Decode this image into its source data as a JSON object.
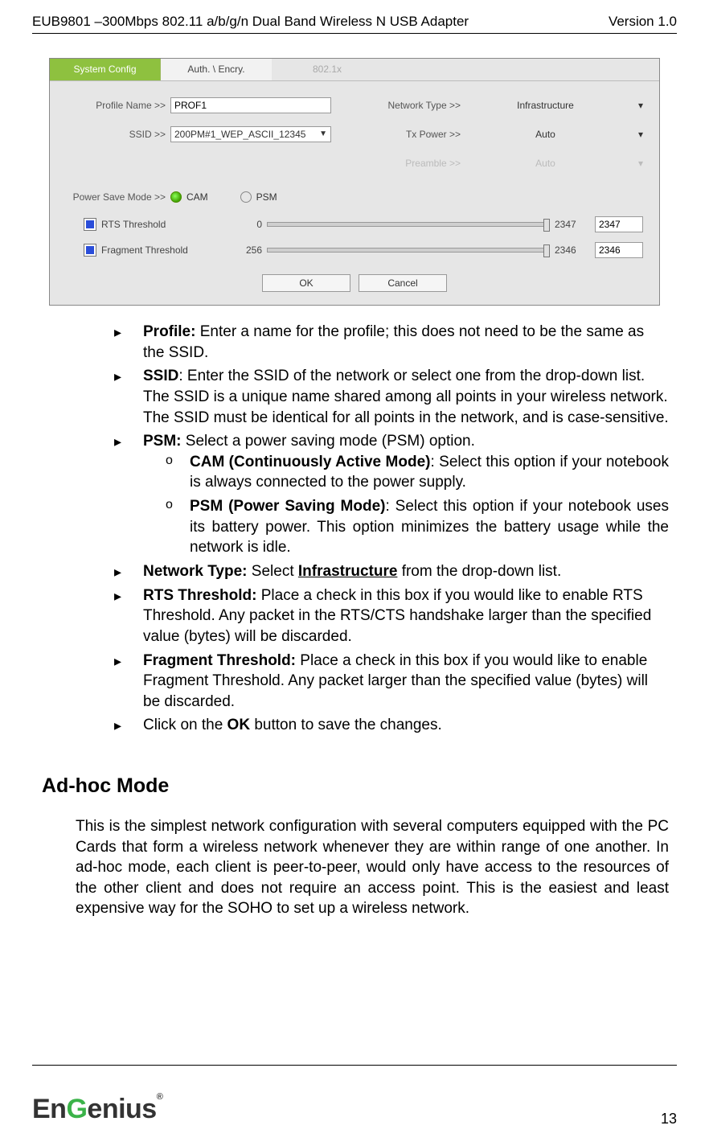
{
  "header": {
    "left": "EUB9801 –300Mbps 802.11 a/b/g/n Dual Band Wireless N USB Adapter",
    "right": "Version 1.0"
  },
  "panel": {
    "tabs": {
      "t1": "System Config",
      "t2": "Auth. \\ Encry.",
      "t3": "802.1x"
    },
    "labels": {
      "profileName": "Profile Name >>",
      "ssid": "SSID >>",
      "networkType": "Network Type >>",
      "txPower": "Tx Power >>",
      "preamble": "Preamble >>",
      "psm": "Power Save Mode >>",
      "cam": "CAM",
      "psmOpt": "PSM",
      "rts": "RTS Threshold",
      "frag": "Fragment Threshold"
    },
    "values": {
      "profileName": "PROF1",
      "ssid": "200PM#1_WEP_ASCII_12345",
      "networkType": "Infrastructure",
      "txPower": "Auto",
      "preamble": "Auto",
      "rtsMin": "0",
      "rtsMax": "2347",
      "rtsVal": "2347",
      "fragMin": "256",
      "fragMax": "2346",
      "fragVal": "2346"
    },
    "buttons": {
      "ok": "OK",
      "cancel": "Cancel"
    }
  },
  "bullets": {
    "profile_b": "Profile:",
    "profile_t": " Enter a name for the profile; this does not need to be the same as the SSID.",
    "ssid_b": "SSID",
    "ssid_t": ": Enter the SSID of the network or select one from the drop-down list. The SSID is a unique name shared among all points in your wireless network. The SSID must be identical for all points in the network, and is case-sensitive.",
    "psm_b": "PSM:",
    "psm_t": " Select a power saving mode (PSM) option.",
    "cam_b": "CAM (Continuously Active Mode)",
    "cam_t": ": Select this option if your notebook is always connected to the power supply.",
    "psmmode_b": "PSM (Power Saving Mode)",
    "psmmode_t": ": Select this option if your notebook uses its battery power. This option minimizes the battery usage while the network is idle.",
    "nt_b": "Network Type:",
    "nt_t1": " Select ",
    "nt_u": "Infrastructure",
    "nt_t2": " from the drop-down list.",
    "rts_b": "RTS Threshold:",
    "rts_t": " Place a check in this box if you would like to enable RTS Threshold. Any packet in the RTS/CTS handshake larger than the specified value (bytes) will be discarded.",
    "frag_b": "Fragment Threshold:",
    "frag_t": " Place a check in this box if you would like to enable Fragment Threshold. Any packet larger than the specified value (bytes) will be discarded.",
    "ok_t1": "Click on the ",
    "ok_b": "OK",
    "ok_t2": " button to save the changes."
  },
  "adhoc": {
    "heading": "Ad-hoc Mode",
    "para": "This is the simplest network configuration with several computers equipped with the PC Cards that form a wireless network whenever they are within range of one another.  In ad-hoc mode, each client is peer-to-peer, would only have access to the resources of the other client and does not require an access point. This is the easiest and least expensive way for the SOHO to set up a wireless network."
  },
  "footer": {
    "brand_pre": "En",
    "brand_g": "G",
    "brand_post": "enius",
    "reg": "®",
    "pagenum": "13"
  }
}
